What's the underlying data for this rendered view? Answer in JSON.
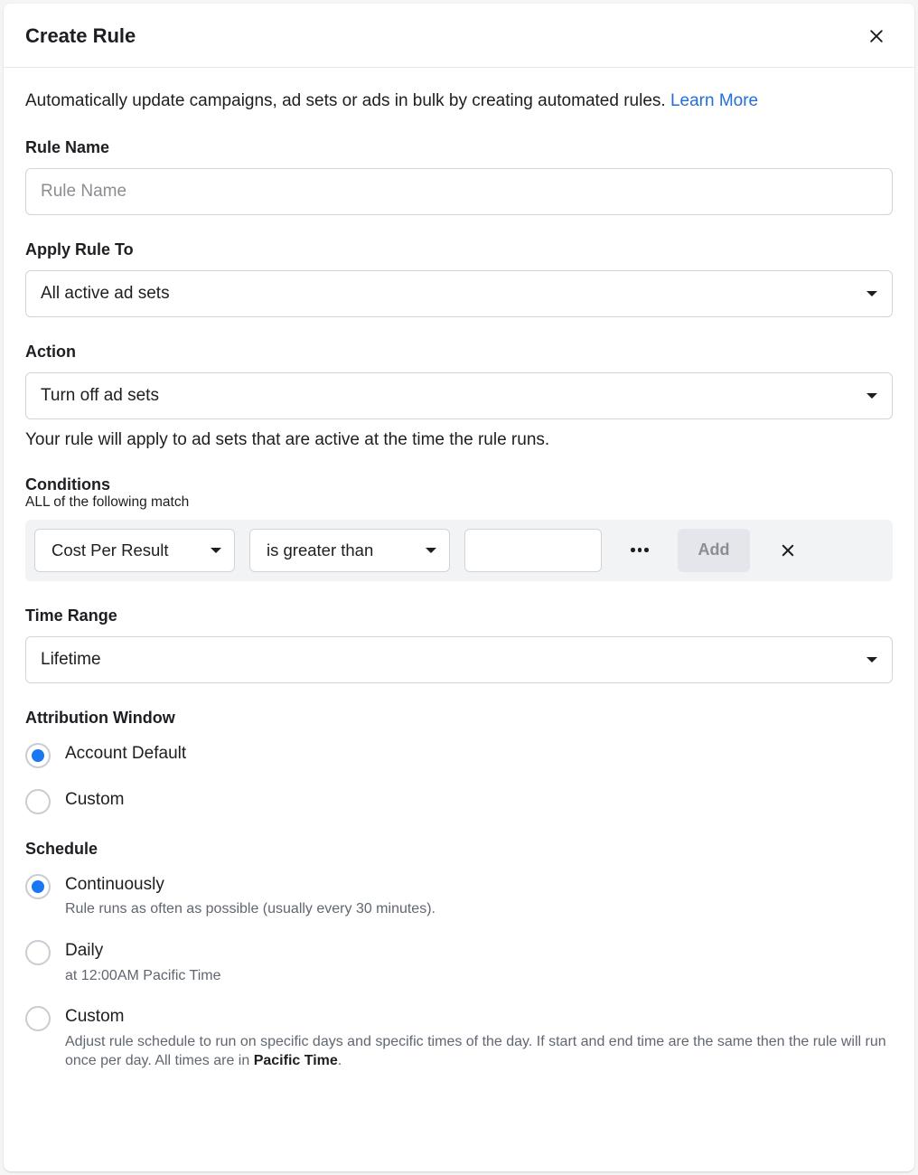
{
  "header": {
    "title": "Create Rule"
  },
  "intro": {
    "text": "Automatically update campaigns, ad sets or ads in bulk by creating automated rules. ",
    "link": "Learn More"
  },
  "ruleName": {
    "label": "Rule Name",
    "placeholder": "Rule Name",
    "value": ""
  },
  "applyTo": {
    "label": "Apply Rule To",
    "selected": "All active ad sets"
  },
  "action": {
    "label": "Action",
    "selected": "Turn off ad sets",
    "helper": "Your rule will apply to ad sets that are active at the time the rule runs."
  },
  "conditions": {
    "label": "Conditions",
    "subLabel": "ALL of the following match",
    "metric": "Cost Per Result",
    "operator": "is greater than",
    "value": "",
    "addLabel": "Add"
  },
  "timeRange": {
    "label": "Time Range",
    "selected": "Lifetime"
  },
  "attribution": {
    "label": "Attribution Window",
    "options": {
      "default": "Account Default",
      "custom": "Custom"
    },
    "selected": "default"
  },
  "schedule": {
    "label": "Schedule",
    "options": {
      "continuous": {
        "main": "Continuously",
        "desc": "Rule runs as often as possible (usually every 30 minutes)."
      },
      "daily": {
        "main": "Daily",
        "desc": "at 12:00AM Pacific Time"
      },
      "custom": {
        "main": "Custom",
        "descPrefix": "Adjust rule schedule to run on specific days and specific times of the day. If start and end time are the same then the rule will run once per day. All times are in ",
        "descBold": "Pacific Time",
        "descSuffix": "."
      }
    },
    "selected": "continuous"
  }
}
